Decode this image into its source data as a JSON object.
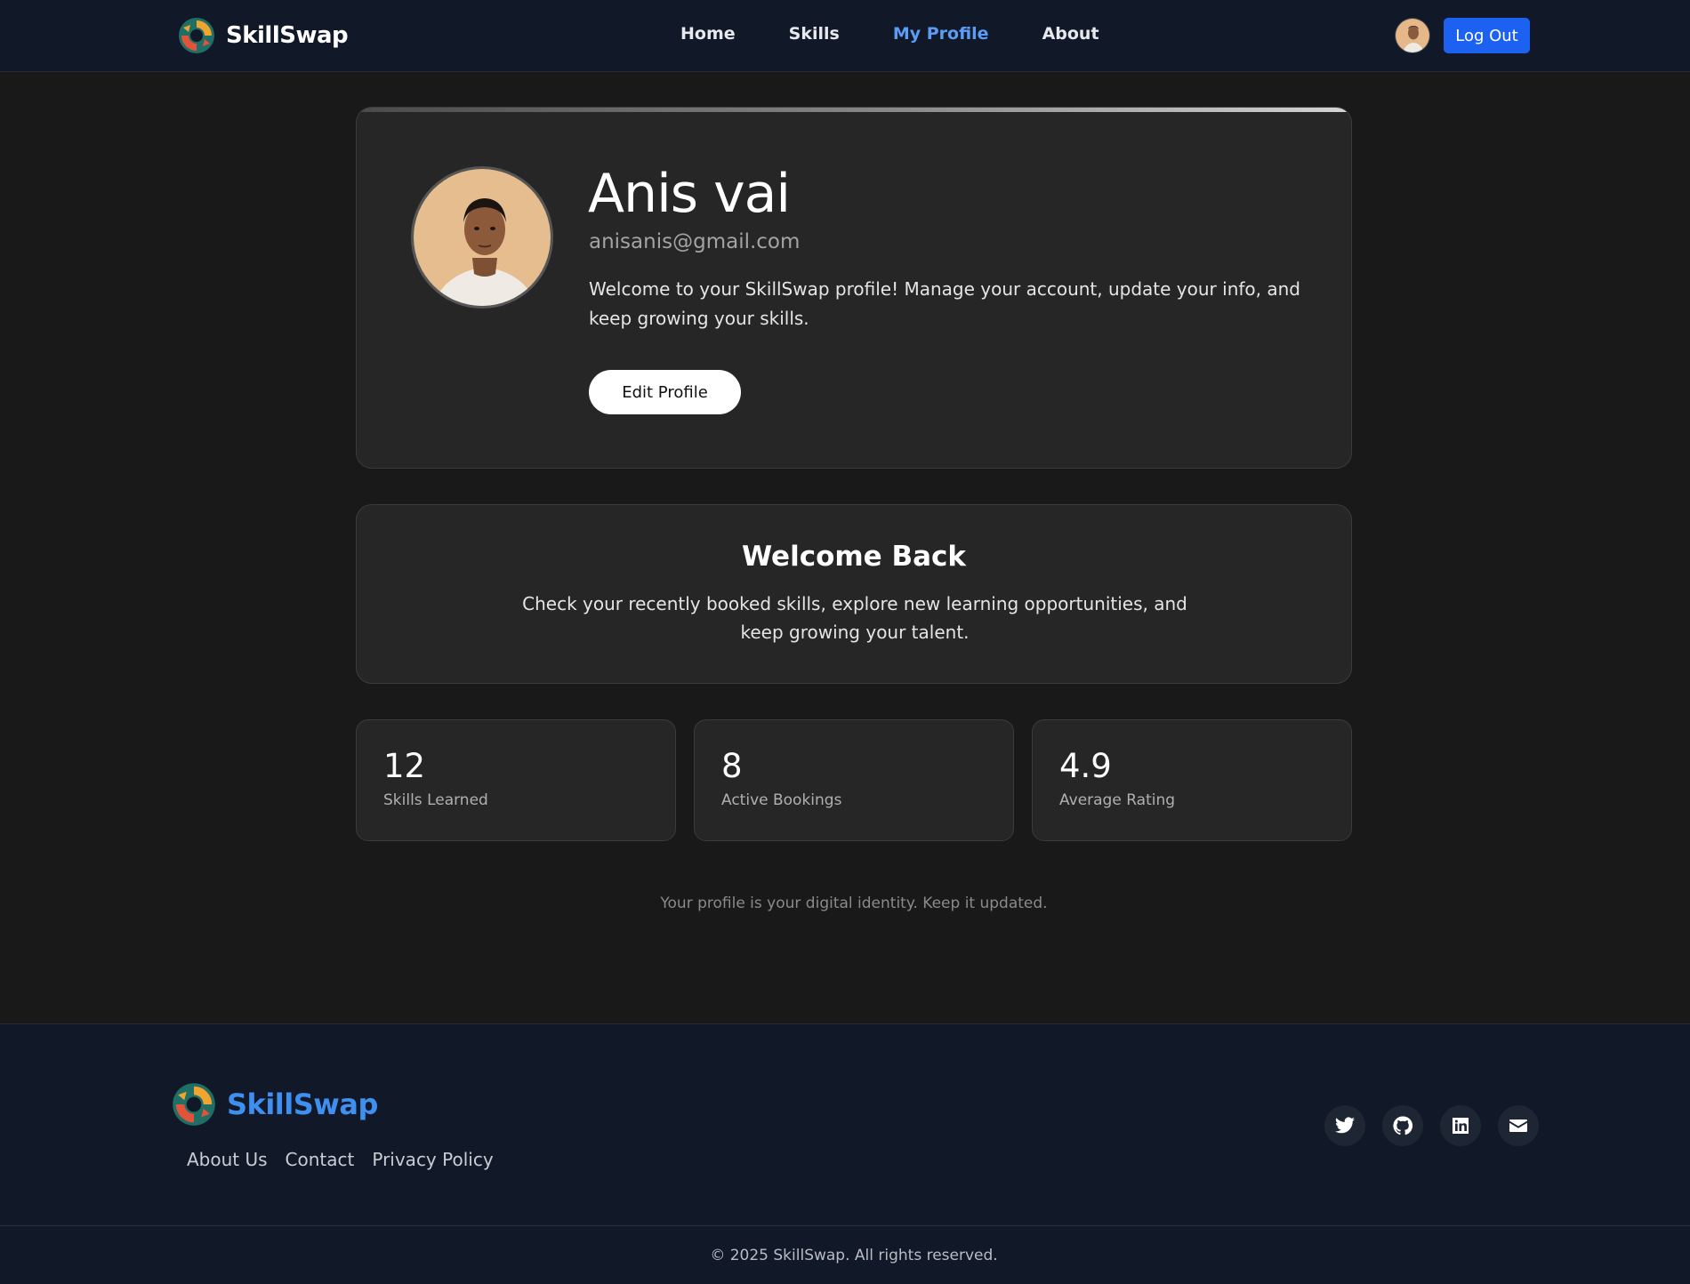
{
  "navbar": {
    "brand": "SkillSwap",
    "links": [
      {
        "label": "Home",
        "active": false
      },
      {
        "label": "Skills",
        "active": false
      },
      {
        "label": "My Profile",
        "active": true
      },
      {
        "label": "About",
        "active": false
      }
    ],
    "logout_label": "Log Out"
  },
  "profile": {
    "name": "Anis vai",
    "email": "anisanis@gmail.com",
    "description": "Welcome to your SkillSwap profile! Manage your account, update your info, and keep growing your skills.",
    "edit_label": "Edit Profile"
  },
  "welcome": {
    "title": "Welcome Back",
    "text": "Check your recently booked skills, explore new learning opportunities, and keep growing your talent."
  },
  "stats": [
    {
      "value": "12",
      "label": "Skills Learned"
    },
    {
      "value": "8",
      "label": "Active Bookings"
    },
    {
      "value": "4.9",
      "label": "Average Rating"
    }
  ],
  "note": "Your profile is your digital identity. Keep it updated.",
  "footer": {
    "brand": "SkillSwap",
    "links": [
      "About Us",
      "Contact",
      "Privacy Policy"
    ],
    "social": [
      "twitter-icon",
      "github-icon",
      "linkedin-icon",
      "mail-icon"
    ],
    "copyright": "© 2025 SkillSwap. All rights reserved."
  },
  "colors": {
    "accent": "#1d61f0",
    "active_link": "#5b9df5",
    "footer_brand": "#3f8ff0",
    "nav_bg": "#111827",
    "page_bg": "#191919",
    "card_bg": "#262626"
  }
}
